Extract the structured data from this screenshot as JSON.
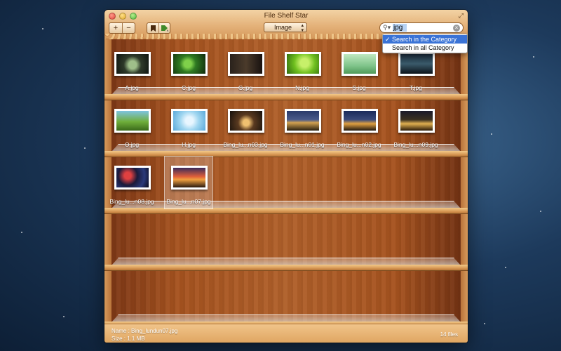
{
  "window": {
    "title": "File Shelf Star"
  },
  "toolbar": {
    "add_label": "+",
    "remove_label": "−",
    "category_label": "Image",
    "search_value": "jpg"
  },
  "search_menu": {
    "options": [
      {
        "label": "Search in the Category",
        "checked": true
      },
      {
        "label": "Search in all Category",
        "checked": false
      }
    ]
  },
  "shelves": [
    {
      "items": [
        {
          "label": "A.jpg"
        },
        {
          "label": "C.jpg"
        },
        {
          "label": "G.jpg"
        },
        {
          "label": "N.jpg"
        },
        {
          "label": "S.jpg"
        },
        {
          "label": "T.jpg"
        }
      ]
    },
    {
      "items": [
        {
          "label": "O.jpg"
        },
        {
          "label": "H.jpg"
        },
        {
          "label": "Bing_lu...n03.jpg"
        },
        {
          "label": "Bing_lu...n01.jpg"
        },
        {
          "label": "Bing_lu...n02.jpg"
        },
        {
          "label": "Bing_lu...n09.jpg"
        }
      ]
    },
    {
      "items": [
        {
          "label": "Bing_lu...n08.jpg"
        },
        {
          "label": "Bing_lu...n07.jpg"
        }
      ]
    }
  ],
  "status": {
    "name": "Name : Bing_lundun07.jpg",
    "size": "Size   : 1.1 MB",
    "count": "14 files"
  }
}
